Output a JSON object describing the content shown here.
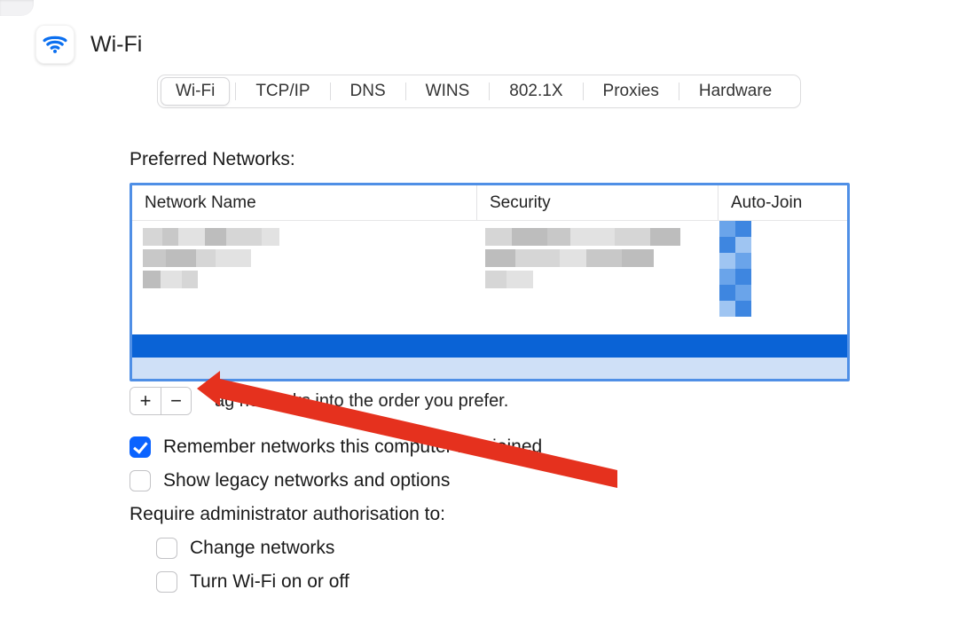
{
  "header": {
    "title": "Wi-Fi"
  },
  "tabs": {
    "items": [
      "Wi-Fi",
      "TCP/IP",
      "DNS",
      "WINS",
      "802.1X",
      "Proxies",
      "Hardware"
    ],
    "active_index": 0
  },
  "preferred_networks": {
    "label": "Preferred Networks:",
    "columns": {
      "name": "Network Name",
      "security": "Security",
      "autojoin": "Auto-Join"
    }
  },
  "under_table": {
    "add_label": "+",
    "remove_label": "−",
    "hint_partial_left": "ag networks into the order you prefer."
  },
  "options": {
    "remember": "Remember networks this computer has joined",
    "legacy": "Show legacy networks and options",
    "require_label": "Require administrator authorisation to:",
    "change_networks": "Change networks",
    "turn_wifi": "Turn Wi-Fi on or off"
  },
  "state": {
    "remember_checked": true,
    "legacy_checked": false,
    "change_networks_checked": false,
    "turn_wifi_checked": false
  }
}
